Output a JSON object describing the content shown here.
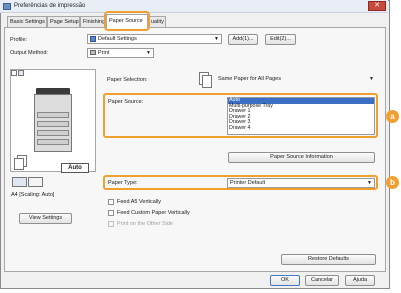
{
  "window": {
    "title": "Preferências de impressão",
    "close_glyph": "✕"
  },
  "tabs": [
    {
      "label": "Basic Settings"
    },
    {
      "label": "Page Setup"
    },
    {
      "label": "Finishing"
    },
    {
      "label": "Paper Source"
    },
    {
      "label": "uality"
    }
  ],
  "profile": {
    "label": "Profile:",
    "value": "Default Settings",
    "add_label": "Add(1)...",
    "edit_label": "Edit(2)..."
  },
  "output_method": {
    "label": "Output Method:",
    "value": "Print"
  },
  "preview": {
    "auto_label": "Auto",
    "status_text": "A4 [Scaling: Auto]",
    "view_settings_label": "View Settings"
  },
  "paper_selection": {
    "label": "Paper Selection:",
    "value": "Same Paper for All Pages"
  },
  "paper_source": {
    "label": "Paper Source:",
    "items": [
      "Auto",
      "Multi-purpose Tray",
      "Drawer 1",
      "Drawer 2",
      "Drawer 3",
      "Drawer 4"
    ],
    "selected_index": 0,
    "info_button_label": "Paper Source Information",
    "badge": "a"
  },
  "paper_type": {
    "label": "Paper Type:",
    "value": "Printer Default",
    "badge": "b"
  },
  "options": [
    {
      "label": "Feed A5 Vertically",
      "checked": false,
      "enabled": true
    },
    {
      "label": "Feed Custom Paper Vertically",
      "checked": false,
      "enabled": true
    },
    {
      "label": "Print on the Other Side",
      "checked": false,
      "enabled": false
    }
  ],
  "footer": {
    "restore_label": "Restore Defaults",
    "ok_label": "OK",
    "cancel_label": "Cancelar",
    "help_label": "Ajuda"
  },
  "colors": {
    "accent_highlight": "#f0a030",
    "selection": "#3a6fc4"
  }
}
